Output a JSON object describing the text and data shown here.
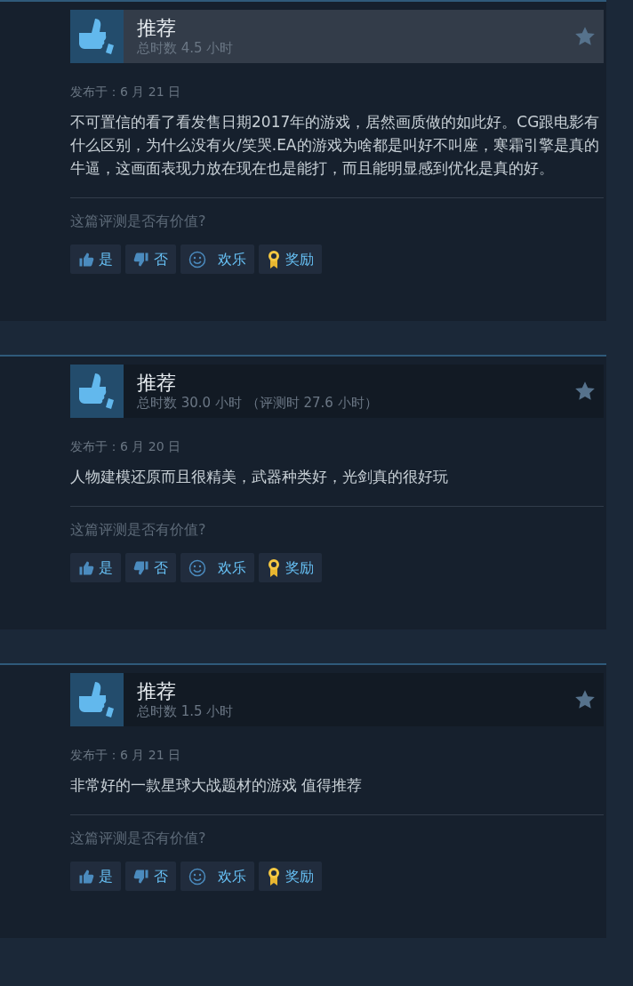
{
  "reviews": [
    {
      "verdict": "推荐",
      "highlighted": true,
      "hours": "总时数 4.5 小时",
      "posted": "发布于：6 月 21 日",
      "text": "不可置信的看了看发售日期2017年的游戏，居然画质做的如此好。CG跟电影有什么区别，为什么没有火/笑哭.EA的游戏为啥都是叫好不叫座，寒霜引擎是真的牛逼，这画面表现力放在现在也是能打，而且能明显感到优化是真的好。",
      "question": "这篇评测是否有价值?",
      "buttons": [
        {
          "kind": "yes",
          "label": "是"
        },
        {
          "kind": "no",
          "label": "否"
        },
        {
          "kind": "funny",
          "label": "欢乐"
        },
        {
          "kind": "award",
          "label": "奖励"
        }
      ]
    },
    {
      "verdict": "推荐",
      "highlighted": false,
      "hours": "总时数 30.0 小时 （评测时 27.6 小时）",
      "posted": "发布于：6 月 20 日",
      "text": "人物建模还原而且很精美，武器种类好，光剑真的很好玩",
      "question": "这篇评测是否有价值?",
      "buttons": [
        {
          "kind": "yes",
          "label": "是"
        },
        {
          "kind": "no",
          "label": "否"
        },
        {
          "kind": "funny",
          "label": "欢乐"
        },
        {
          "kind": "award",
          "label": "奖励"
        }
      ]
    },
    {
      "verdict": "推荐",
      "highlighted": false,
      "hours": "总时数 1.5 小时",
      "posted": "发布于：6 月 21 日",
      "text": "非常好的一款星球大战题材的游戏 值得推荐",
      "question": "这篇评测是否有价值?",
      "buttons": [
        {
          "kind": "yes",
          "label": "是"
        },
        {
          "kind": "no",
          "label": "否"
        },
        {
          "kind": "funny",
          "label": "欢乐"
        },
        {
          "kind": "award",
          "label": "奖励"
        }
      ]
    }
  ]
}
